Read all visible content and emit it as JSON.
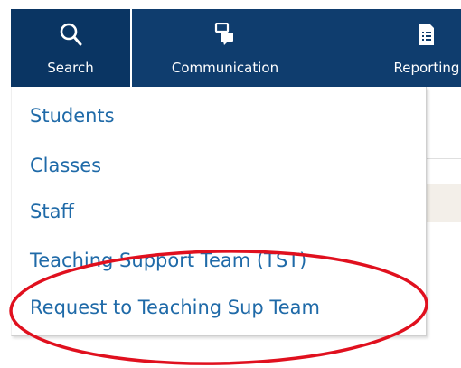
{
  "nav": {
    "search": {
      "label": "Search",
      "icon": "search-icon"
    },
    "communication": {
      "label": "Communication",
      "icon": "chat-bubbles-icon"
    },
    "reporting": {
      "label": "Reporting",
      "icon": "report-document-icon"
    }
  },
  "dropdown": {
    "items": [
      {
        "label": "Students"
      },
      {
        "label": "Classes"
      },
      {
        "label": "Staff"
      },
      {
        "label": "Teaching Support Team (TST)"
      },
      {
        "label": "Request to Teaching Sup Team"
      }
    ]
  },
  "colors": {
    "nav_bg": "#0f3d6e",
    "link": "#1f6aa8",
    "highlight_ellipse": "#e0101e"
  }
}
